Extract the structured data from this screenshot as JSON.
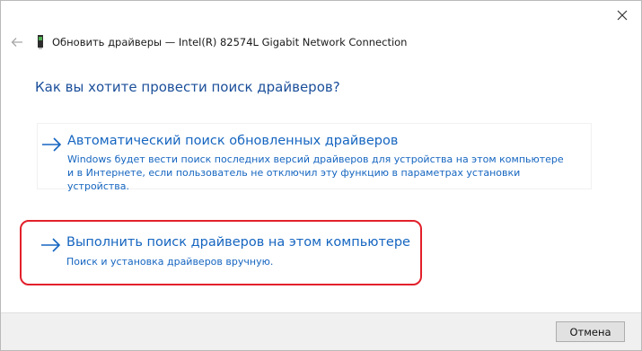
{
  "window": {
    "title": "Обновить драйверы — Intel(R) 82574L Gigabit Network Connection",
    "question": "Как вы хотите провести поиск драйверов?"
  },
  "options": [
    {
      "title": "Автоматический поиск обновленных драйверов",
      "description": "Windows будет вести поиск последних версий драйверов для устройства на этом компьютере и в Интернете, если пользователь не отключил эту функцию в параметрах установки устройства."
    },
    {
      "title": "Выполнить поиск драйверов на этом компьютере",
      "description": "Поиск и установка драйверов вручную."
    }
  ],
  "footer": {
    "cancel_label": "Отмена"
  },
  "colors": {
    "link_blue": "#1565c0",
    "heading_blue": "#1b4f9a",
    "highlight_red": "#e2202b"
  },
  "icons": [
    "close-icon",
    "back-arrow-icon",
    "device-icon",
    "arrow-right-icon"
  ]
}
